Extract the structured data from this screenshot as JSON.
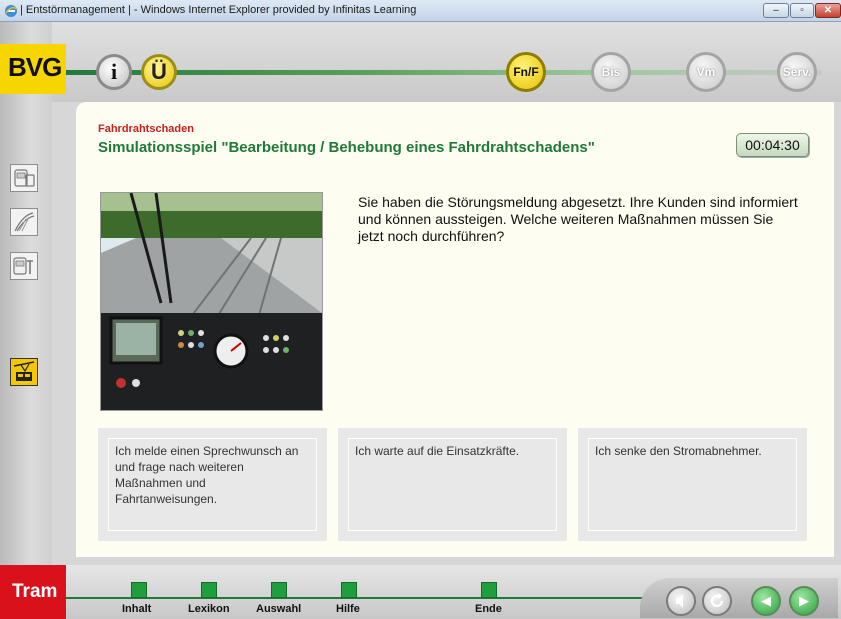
{
  "window": {
    "title": "| Entstörmanagement | - Windows Internet Explorer provided by Infinitas Learning",
    "minimize_symbol": "–",
    "maximize_symbol": "▫",
    "close_symbol": "✕"
  },
  "header": {
    "logo": "BVG",
    "info_button": "i",
    "ue_button": "Ü",
    "nav": [
      "Fn/F",
      "Bis",
      "Vm",
      "Serv."
    ]
  },
  "sidebar": {
    "icons": [
      "tram-front-icon",
      "pantograph-icon",
      "tram-tool-icon",
      "overhead-wire-icon"
    ],
    "active_color": "#f3c800"
  },
  "main": {
    "subtitle": "Fahrdrahtschaden",
    "heading": "Simulationsspiel \"Bearbeitung / Behebung eines Fahrdrahtschadens\"",
    "timer": "00:04:30",
    "question": "Sie haben die Störungsmeldung abgesetzt. Ihre Kunden sind informiert und können aussteigen. Welche weiteren Maßnahmen müssen Sie jetzt noch durchführen?",
    "answers": [
      "Ich melde einen Sprechwunsch an und frage nach weiteren Maßnahmen und Fahrtanweisungen.",
      "Ich warte auf die Einsatzkräfte.",
      "Ich senke den Stromabnehmer."
    ]
  },
  "footer": {
    "mode": "Tram",
    "links": [
      "Inhalt",
      "Lexikon",
      "Auswahl",
      "Hilfe",
      "Ende"
    ],
    "controls": {
      "sound_icon": "speaker-icon",
      "refresh_icon": "refresh-icon",
      "back_symbol": "◀",
      "forward_symbol": "▶"
    }
  },
  "colors": {
    "brand_yellow": "#f6d500",
    "brand_green": "#1f7a3a",
    "alert_red": "#c81e1e",
    "tram_red": "#d8111b"
  }
}
